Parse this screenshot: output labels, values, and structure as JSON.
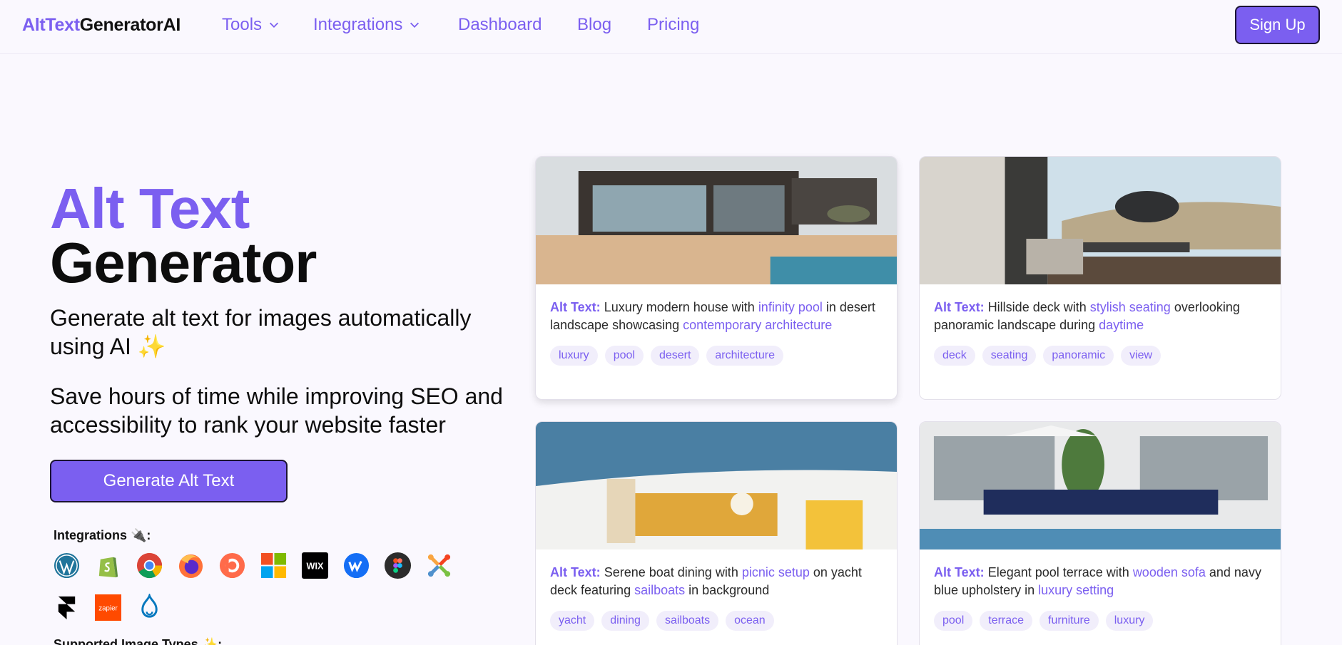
{
  "nav": {
    "logo_part1": "AltText",
    "logo_part2": "GeneratorAI",
    "tools": "Tools",
    "integrations": "Integrations",
    "dashboard": "Dashboard",
    "blog": "Blog",
    "pricing": "Pricing",
    "signup": "Sign Up"
  },
  "hero": {
    "title_line1": "Alt Text",
    "title_line2": "Generator",
    "subtitle1": "Generate alt text for images automatically using AI ✨",
    "subtitle2": "Save hours of time while improving SEO and accessibility to rank your website faster",
    "cta": "Generate Alt Text",
    "integrations_label": "Integrations 🔌:",
    "supported_label": "Supported Image Types ✨:"
  },
  "integrations": [
    "wordpress-icon",
    "shopify-icon",
    "chrome-icon",
    "firefox-icon",
    "dribbble-icon",
    "microsoft-icon",
    "wix-icon",
    "webflow-icon",
    "figma-icon",
    "joomla-icon",
    "framer-icon",
    "zapier-icon",
    "drupal-icon"
  ],
  "cards": [
    {
      "alt_label": "Alt Text:",
      "segments": [
        {
          "t": "Luxury modern house",
          "h": false
        },
        {
          "t": " with ",
          "h": false
        },
        {
          "t": "infinity pool",
          "h": true
        },
        {
          "t": " in desert landscape",
          "h": false
        },
        {
          "t": " showcasing ",
          "h": false
        },
        {
          "t": "contemporary architecture",
          "h": true
        }
      ],
      "tags": [
        "luxury",
        "pool",
        "desert",
        "architecture"
      ]
    },
    {
      "alt_label": "Alt Text:",
      "segments": [
        {
          "t": "Hillside deck",
          "h": false
        },
        {
          "t": " with ",
          "h": false
        },
        {
          "t": "stylish seating",
          "h": true
        },
        {
          "t": " overlooking panoramic landscape",
          "h": false
        },
        {
          "t": " during ",
          "h": false
        },
        {
          "t": "daytime",
          "h": true
        }
      ],
      "tags": [
        "deck",
        "seating",
        "panoramic",
        "view"
      ]
    },
    {
      "alt_label": "Alt Text:",
      "segments": [
        {
          "t": "Serene boat dining",
          "h": false
        },
        {
          "t": " with ",
          "h": false
        },
        {
          "t": "picnic setup",
          "h": true
        },
        {
          "t": " on yacht deck",
          "h": false
        },
        {
          "t": " featuring ",
          "h": false
        },
        {
          "t": "sailboats",
          "h": true
        },
        {
          "t": " in background",
          "h": false
        }
      ],
      "tags": [
        "yacht",
        "dining",
        "sailboats",
        "ocean"
      ]
    },
    {
      "alt_label": "Alt Text:",
      "segments": [
        {
          "t": "Elegant pool terrace",
          "h": false
        },
        {
          "t": " with ",
          "h": false
        },
        {
          "t": "wooden sofa",
          "h": true
        },
        {
          "t": " and navy blue upholstery",
          "h": false
        },
        {
          "t": " in ",
          "h": false
        },
        {
          "t": "luxury setting",
          "h": true
        }
      ],
      "tags": [
        "pool",
        "terrace",
        "furniture",
        "luxury"
      ]
    }
  ],
  "colors": {
    "accent": "#7b5ff0",
    "background": "#faf8fe"
  }
}
